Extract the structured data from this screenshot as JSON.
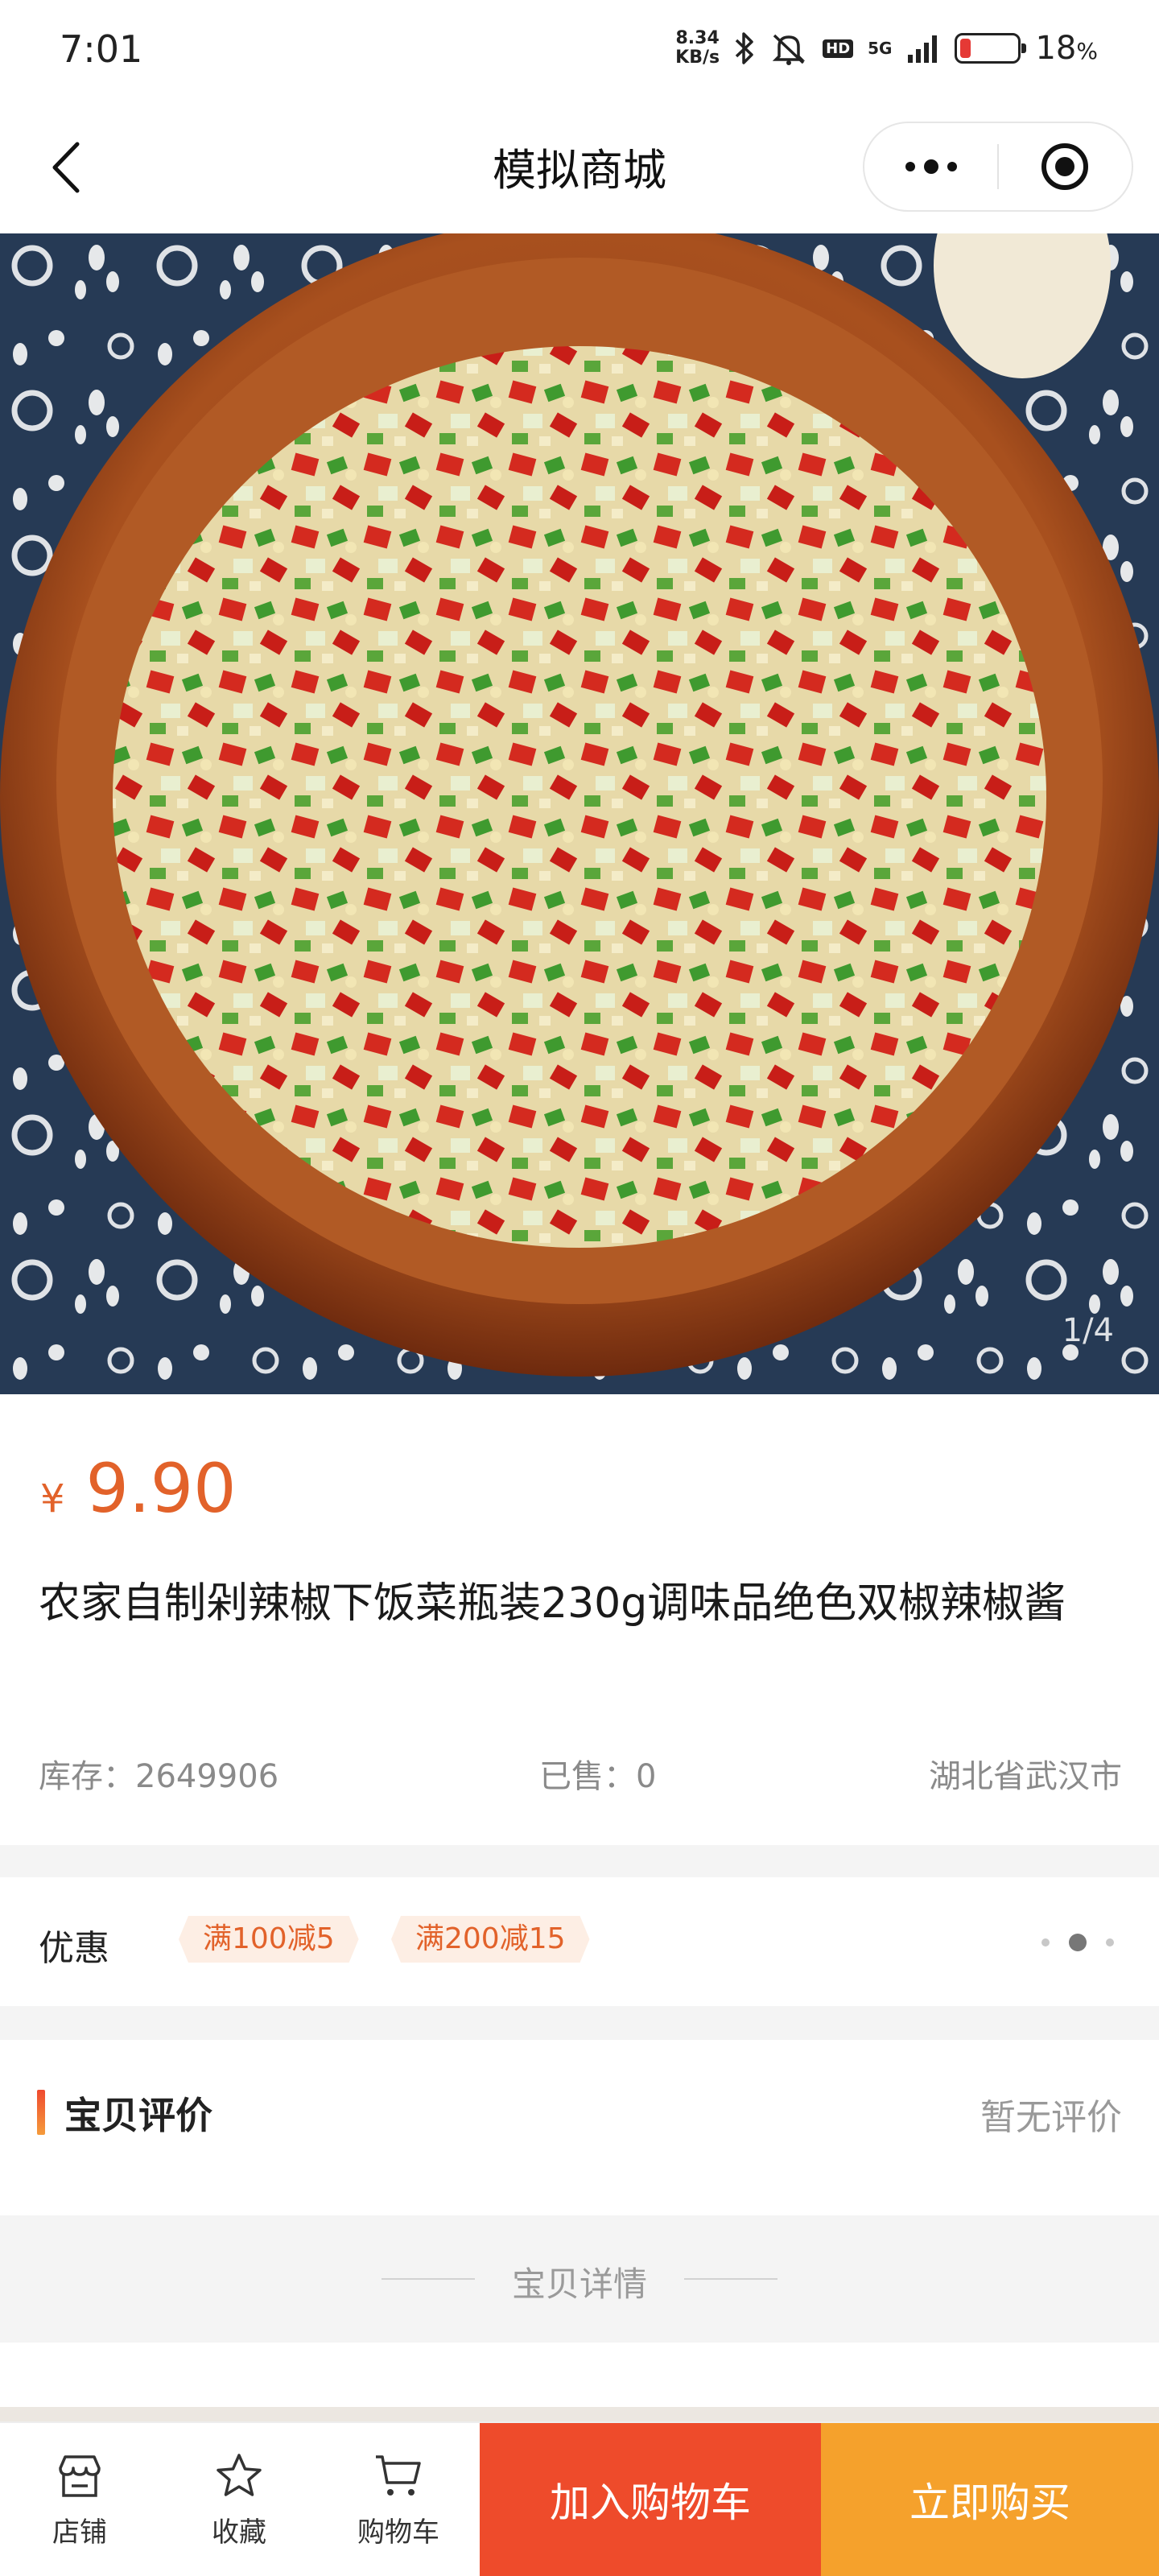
{
  "status_bar": {
    "time": "7:01",
    "net_speed_value": "8.34",
    "net_speed_unit": "KB/s",
    "hd_label": "HD",
    "network_label": "5G",
    "battery_percent": "18",
    "battery_unit": "%",
    "battery_level": 0.18,
    "icons": [
      "bluetooth-icon",
      "mute-icon",
      "signal-icon",
      "battery-icon"
    ]
  },
  "nav": {
    "title": "模拟商城",
    "icons": [
      "back-icon",
      "more-icon",
      "target-icon"
    ]
  },
  "gallery": {
    "indicator": "1/4"
  },
  "product": {
    "currency": "¥",
    "price": "9.90",
    "title": "农家自制剁辣椒下饭菜瓶装230g调味品绝色双椒辣椒酱",
    "stock_label": "库存：",
    "stock_value": "2649906",
    "sold_label": "已售：",
    "sold_value": "0",
    "location": "湖北省武汉市"
  },
  "promotions": {
    "label": "优惠",
    "tags": [
      "满100减5",
      "满200减15"
    ]
  },
  "reviews": {
    "title": "宝贝评价",
    "empty_text": "暂无评价"
  },
  "details": {
    "title": "宝贝详情"
  },
  "bottom_bar": {
    "items": [
      {
        "label": "店铺",
        "icon": "store-icon"
      },
      {
        "label": "收藏",
        "icon": "star-icon"
      },
      {
        "label": "购物车",
        "icon": "cart-icon"
      }
    ],
    "add_to_cart": "加入购物车",
    "buy_now": "立即购买"
  },
  "colors": {
    "price": "#e2622a",
    "add_to_cart_bg": "#ee4b2b",
    "buy_now_bg": "#f5a12c",
    "promo_tag_bg": "#fdeee4"
  }
}
